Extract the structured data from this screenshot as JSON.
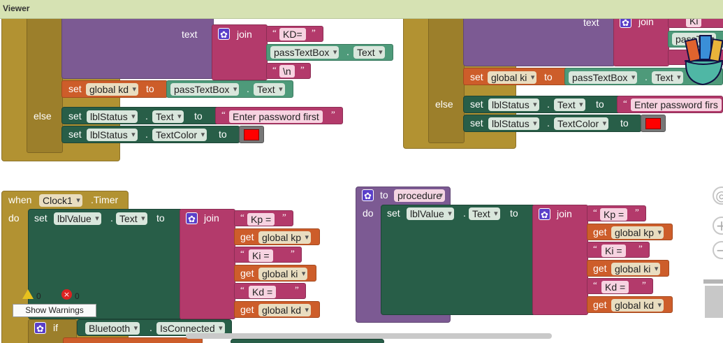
{
  "viewer": {
    "title": "Viewer"
  },
  "blocks": {
    "top_left": {
      "text_label": "text",
      "join": "join",
      "kd_str": "KD=",
      "passtext_1": "passTextBox",
      "text_prop_1": "Text",
      "newline": "\\n",
      "set_word": "set",
      "global_kd": "global kd",
      "to": "to",
      "passtext_2": "passTextBox",
      "text_prop_2": "Text",
      "else": "else",
      "lblstatus_1": "lblStatus",
      "text_prop_3": "Text",
      "enter_pw": "Enter password first",
      "lblstatus_2": "lblStatus",
      "textcolor": "TextColor"
    },
    "top_right": {
      "text_label": "text",
      "join": "join",
      "ki_frag": "Ki",
      "pass_frag": "passTe",
      "set_word": "set",
      "global_ki": "global ki",
      "to": "to",
      "passtext": "passTextBox",
      "text_prop": "Text",
      "else": "else",
      "lblstatus_1": "lblStatus",
      "text_prop_2": "Text",
      "enter_pw": "Enter password firs",
      "lblstatus_2": "lblStatus",
      "textcolor": "TextColor"
    },
    "clock": {
      "when": "when",
      "component": "Clock1",
      "event": ".Timer",
      "do": "do",
      "set_word": "set",
      "lblvalue": "lblValue",
      "text_prop": "Text",
      "to": "to",
      "join": "join",
      "kp_str": "Kp =",
      "get": "get",
      "global_kp": "global kp",
      "ki_str": "Ki =",
      "global_ki": "global ki",
      "kd_str": "Kd =",
      "global_kd": "global kd",
      "if": "if",
      "bluetooth": "Bluetooth",
      "isconnected": "IsConnected"
    },
    "procedure": {
      "to": "to",
      "name": "procedure",
      "do": "do",
      "set_word": "set",
      "lblvalue": "lblValue",
      "text_prop": "Text",
      "to2": "to",
      "join": "join",
      "kp_str": "Kp =",
      "get": "get",
      "global_kp": "global kp",
      "ki_str": "Ki =",
      "global_ki": "global ki",
      "kd_str": "Kd =",
      "global_kd": "global kd"
    }
  },
  "warnings": {
    "warning_count": "0",
    "error_count": "0",
    "show_warnings": "Show Warnings"
  },
  "controls": {
    "zoom_in": "+",
    "zoom_out": "−"
  },
  "colors": {
    "viewer_bar": "#d6e2b3",
    "control": "#b29232",
    "component": "#285e48",
    "text": "#b33a6b",
    "variable": "#cd5d2a",
    "procedure": "#7c5a93",
    "color_swatch": "#ff0000"
  }
}
